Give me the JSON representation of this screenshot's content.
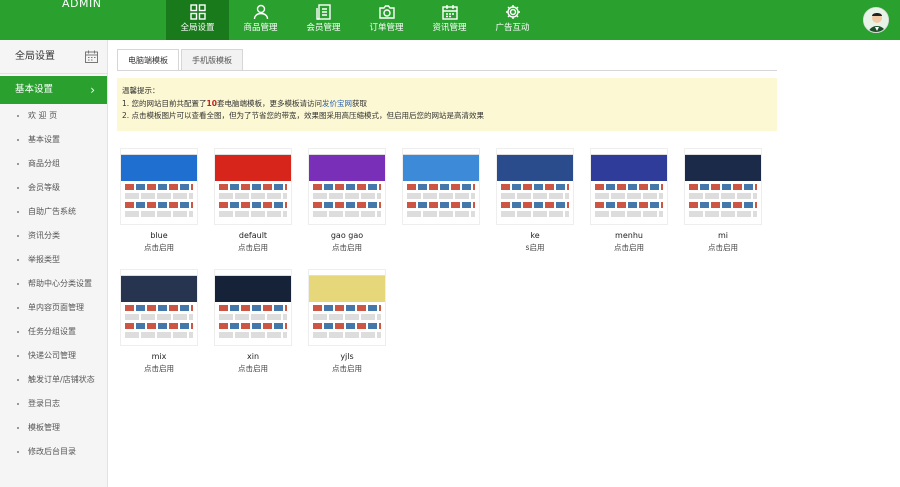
{
  "header": {
    "brand": "ADMIN",
    "nav": [
      {
        "label": "全局设置",
        "icon": "grid-icon",
        "active": true
      },
      {
        "label": "商品管理",
        "icon": "user-icon",
        "active": false
      },
      {
        "label": "会员管理",
        "icon": "document-icon",
        "active": false
      },
      {
        "label": "订单管理",
        "icon": "camera-icon",
        "active": false
      },
      {
        "label": "资讯管理",
        "icon": "calendar-icon",
        "active": false
      },
      {
        "label": "广告互动",
        "icon": "gear-icon",
        "active": false
      }
    ]
  },
  "sidebar": {
    "title": "全局设置",
    "group": "基本设置",
    "items": [
      "欢 迎 页",
      "基本设置",
      "商品分组",
      "会员等级",
      "自助广告系统",
      "资讯分类",
      "举报类型",
      "帮助中心分类设置",
      "单内容页面管理",
      "任务分组设置",
      "快递公司管理",
      "触发订单/店铺状态",
      "登录日志",
      "模板管理",
      "修改后台目录"
    ]
  },
  "tabs": [
    "电脑端模板",
    "手机版模板"
  ],
  "tips": {
    "title": "温馨提示：",
    "line1_a": "1.  您的网站目前共配置了",
    "line1_num": "10",
    "line1_b": "套电脑端模板，更多模板请访问",
    "line1_link": "发价宝网",
    "line1_c": "获取",
    "line2": "2.  点击模板图片可以查看全图，但为了节省您的带宽，效果图采用高压缩模式，但启用后您的网站是高清效果"
  },
  "templates": [
    {
      "name": "blue",
      "action": "点击启用",
      "color": "#1e6fd0"
    },
    {
      "name": "default",
      "action": "点击启用",
      "color": "#d8251b"
    },
    {
      "name": "gao    gao",
      "action": "点击启用",
      "color": "#7a2fb8"
    },
    {
      "name": "",
      "action": "",
      "color": "#3d8ad8"
    },
    {
      "name": "ke",
      "action": "s启用",
      "color": "#2a4c8c"
    },
    {
      "name": "menhu",
      "action": "点击启用",
      "color": "#2f3c9a"
    },
    {
      "name": "mi",
      "action": "点击启用",
      "color": "#1b2a48"
    },
    {
      "name": "mix",
      "action": "点击启用",
      "color": "#27344f"
    },
    {
      "name": "xin",
      "action": "点击启用",
      "color": "#152238"
    },
    {
      "name": "yjls",
      "action": "点击启用",
      "color": "#e5d77a"
    }
  ]
}
